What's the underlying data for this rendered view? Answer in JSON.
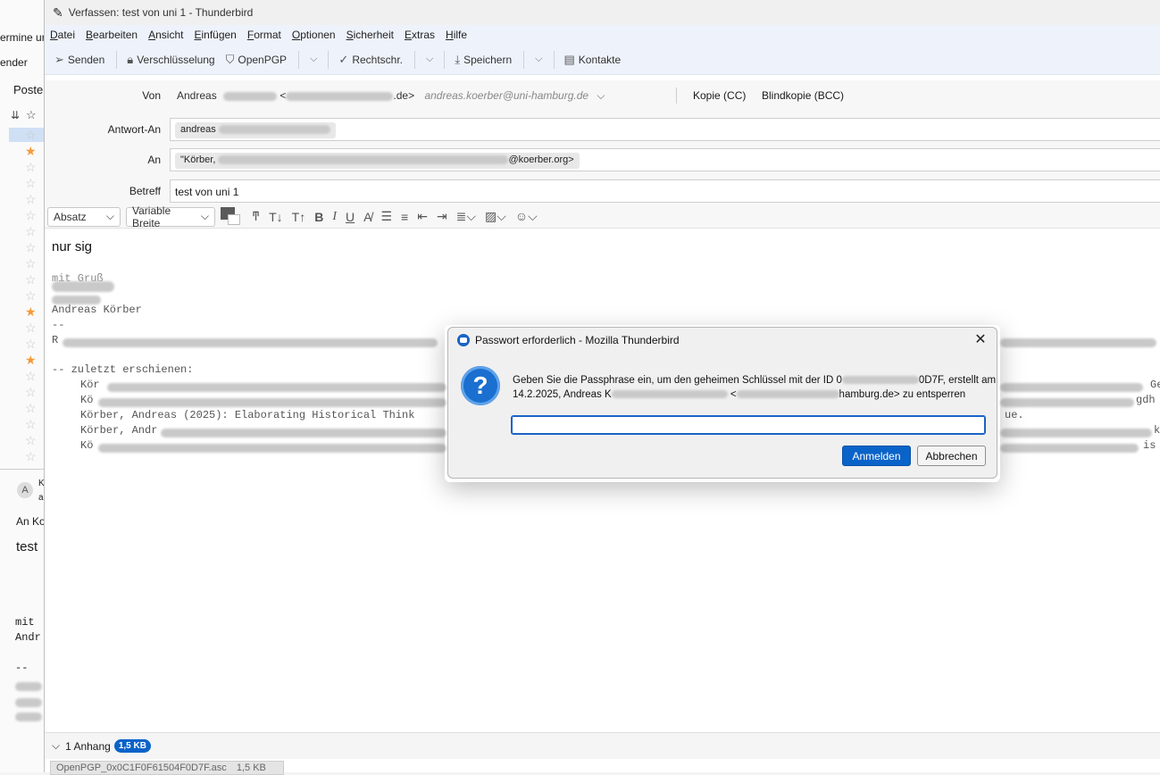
{
  "background": {
    "texts": [
      "ermine ur",
      "ender",
      "Poste",
      "A",
      "K",
      "a",
      "An Ko",
      "test",
      "mit",
      "Andr",
      "--"
    ]
  },
  "compose": {
    "title": "Verfassen: test von uni 1 - Thunderbird",
    "menu": [
      "Datei",
      "Bearbeiten",
      "Ansicht",
      "Einfügen",
      "Format",
      "Optionen",
      "Sicherheit",
      "Extras",
      "Hilfe"
    ],
    "toolbar": {
      "send": "Senden",
      "encrypt": "Verschlüsselung",
      "openpgp": "OpenPGP",
      "spelling": "Rechtschr.",
      "save": "Speichern",
      "contacts": "Kontakte"
    },
    "headers": {
      "from_label": "Von",
      "from_name": "Andreas",
      "from_email_tail": ".de>",
      "from_identity": "andreas.koerber@uni-hamburg.de",
      "cc": "Kopie (CC)",
      "bcc": "Blindkopie (BCC)",
      "reply_label": "Antwort-An",
      "reply_value": "andreas",
      "to_label": "An",
      "to_value_start": "\"Körber,",
      "to_value_end": "@koerber.org>",
      "subject_label": "Betreff",
      "subject_value": "test von uni 1"
    },
    "format": {
      "paragraph": "Absatz",
      "font": "Variable Breite"
    },
    "body": {
      "first_line": "nur sig",
      "lines": [
        "mit Gruß",
        "Andreas Körber",
        "--",
        "R",
        "-- zuletzt erschienen:",
        "Kör",
        "Kö",
        "Körber, Andreas (2025): Elaborating Historical Think",
        "Körber, Andr",
        "Kö"
      ],
      "right_fragments": [
        "G",
        "Ge",
        "gdh",
        "ue.",
        "k",
        "is"
      ]
    },
    "attachments": {
      "label": "1 Anhang",
      "size": "1,5 KB",
      "item": "OpenPGP_0x0C1F0F61504F0D7F.asc",
      "item_size": "1,5 KB"
    }
  },
  "dialog": {
    "title": "Passwort erforderlich - Mozilla Thunderbird",
    "message_start": "Geben Sie die Passphrase ein, um den geheimen Schlüssel mit der ID 0",
    "message_id_end": "0D7F, erstellt am",
    "message_line2_start": "14.2.2025, Andreas K",
    "message_line2_end": "hamburg.de> zu entsperren",
    "input_value": "",
    "ok": "Anmelden",
    "cancel": "Abbrechen"
  }
}
